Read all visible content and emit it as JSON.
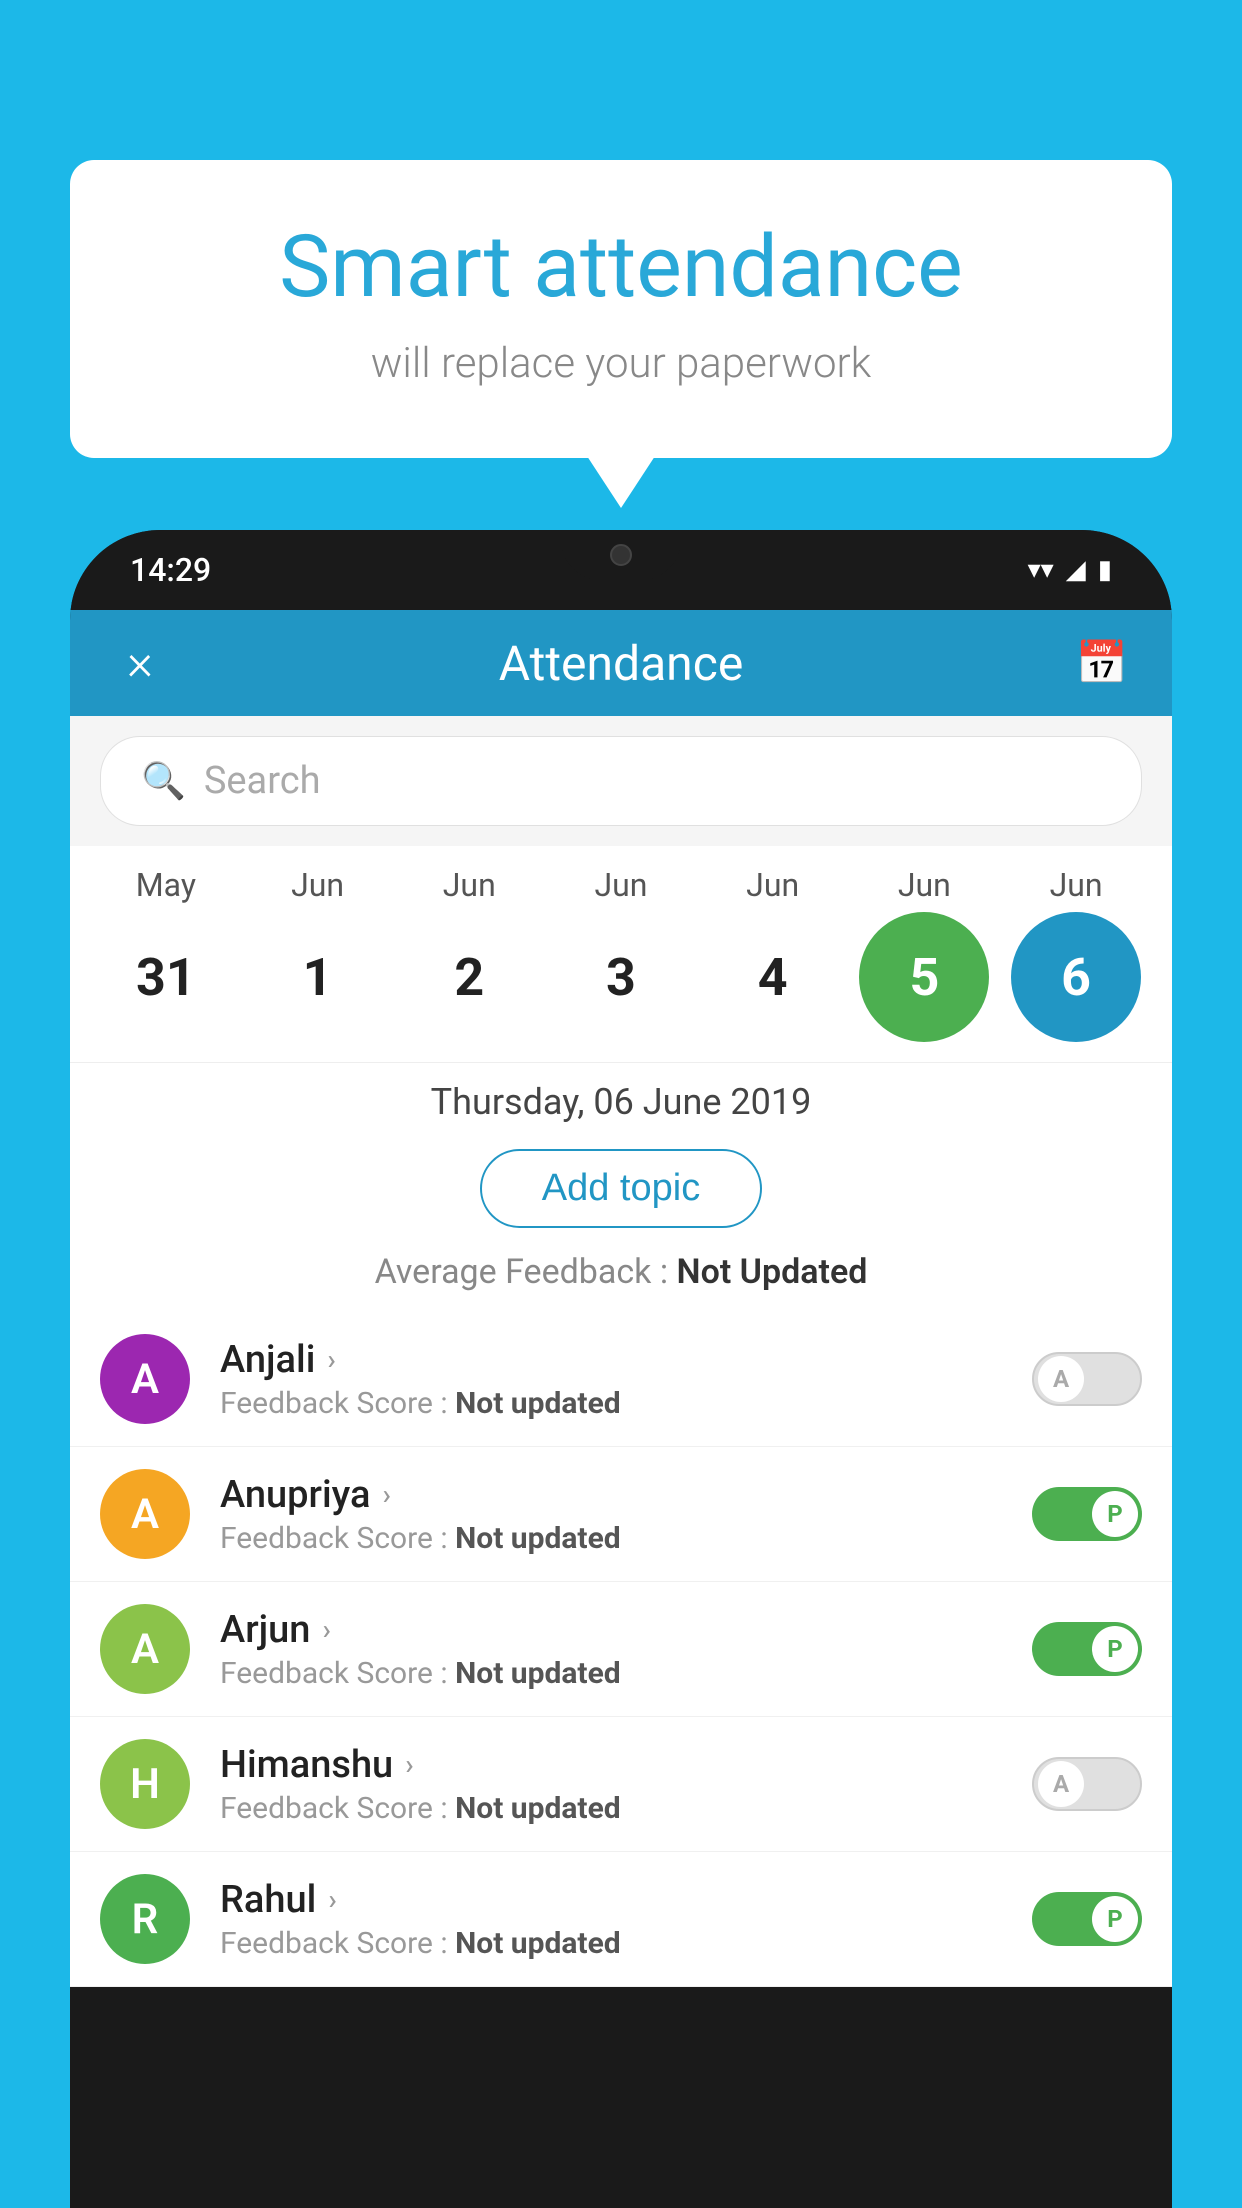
{
  "background_color": "#1cb8e8",
  "bubble": {
    "title": "Smart attendance",
    "subtitle": "will replace your paperwork"
  },
  "status_bar": {
    "time": "14:29",
    "icons": [
      "wifi",
      "signal",
      "battery"
    ]
  },
  "header": {
    "close_label": "×",
    "title": "Attendance",
    "calendar_icon": "📅"
  },
  "search": {
    "placeholder": "Search"
  },
  "calendar": {
    "months": [
      "May",
      "Jun",
      "Jun",
      "Jun",
      "Jun",
      "Jun",
      "Jun"
    ],
    "dates": [
      "31",
      "1",
      "2",
      "3",
      "4",
      "5",
      "6"
    ],
    "today_index": 5,
    "selected_index": 6
  },
  "selected_date_label": "Thursday, 06 June 2019",
  "add_topic_label": "Add topic",
  "feedback_summary": {
    "label": "Average Feedback : ",
    "value": "Not Updated"
  },
  "students": [
    {
      "name": "Anjali",
      "avatar_letter": "A",
      "avatar_color": "#9c27b0",
      "feedback_label": "Feedback Score : ",
      "feedback_value": "Not updated",
      "toggle_state": "off",
      "toggle_label": "A"
    },
    {
      "name": "Anupriya",
      "avatar_letter": "A",
      "avatar_color": "#f5a623",
      "feedback_label": "Feedback Score : ",
      "feedback_value": "Not updated",
      "toggle_state": "on",
      "toggle_label": "P"
    },
    {
      "name": "Arjun",
      "avatar_letter": "A",
      "avatar_color": "#8bc34a",
      "feedback_label": "Feedback Score : ",
      "feedback_value": "Not updated",
      "toggle_state": "on",
      "toggle_label": "P"
    },
    {
      "name": "Himanshu",
      "avatar_letter": "H",
      "avatar_color": "#8bc34a",
      "feedback_label": "Feedback Score : ",
      "feedback_value": "Not updated",
      "toggle_state": "off",
      "toggle_label": "A"
    },
    {
      "name": "Rahul",
      "avatar_letter": "R",
      "avatar_color": "#4caf50",
      "feedback_label": "Feedback Score : ",
      "feedback_value": "Not updated",
      "toggle_state": "on",
      "toggle_label": "P"
    }
  ]
}
